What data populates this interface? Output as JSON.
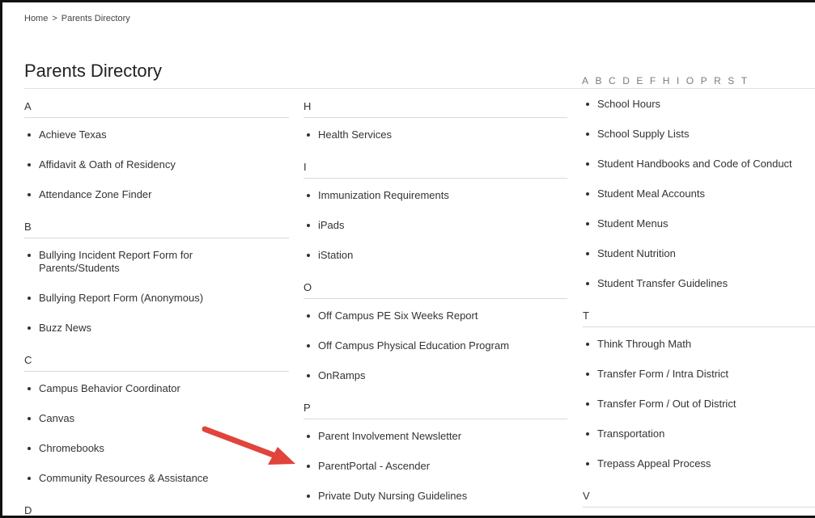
{
  "breadcrumb": {
    "home": "Home",
    "separator": ">",
    "current": "Parents Directory"
  },
  "page_title": "Parents Directory",
  "alpha_nav": [
    "A",
    "B",
    "C",
    "D",
    "E",
    "F",
    "H",
    "I",
    "O",
    "P",
    "R",
    "S",
    "T"
  ],
  "columns": [
    {
      "groups": [
        {
          "letter": "A",
          "items": [
            "Achieve Texas",
            "Affidavit & Oath of Residency",
            "Attendance Zone Finder"
          ]
        },
        {
          "letter": "B",
          "items": [
            "Bullying Incident Report Form for Parents/Students",
            "Bullying Report Form (Anonymous)",
            "Buzz News"
          ]
        },
        {
          "letter": "C",
          "items": [
            "Campus Behavior Coordinator",
            "Canvas",
            "Chromebooks",
            "Community Resources & Assistance"
          ]
        },
        {
          "letter": "D",
          "items": []
        }
      ]
    },
    {
      "groups": [
        {
          "letter": "H",
          "items": [
            "Health Services"
          ]
        },
        {
          "letter": "I",
          "items": [
            "Immunization Requirements",
            "iPads",
            "iStation"
          ]
        },
        {
          "letter": "O",
          "items": [
            "Off Campus PE Six Weeks Report",
            "Off Campus Physical Education Program",
            "OnRamps"
          ]
        },
        {
          "letter": "P",
          "items": [
            "Parent Involvement Newsletter",
            "ParentPortal - Ascender",
            "Private Duty Nursing Guidelines"
          ]
        }
      ]
    },
    {
      "s_items": [
        "School Hours",
        "School Supply Lists",
        "Student Handbooks and Code of Conduct",
        "Student Meal Accounts",
        "Student Menus",
        "Student Nutrition",
        "Student Transfer Guidelines"
      ],
      "groups": [
        {
          "letter": "T",
          "items": [
            "Think Through Math",
            "Transfer Form / Intra District",
            "Transfer Form / Out of District",
            "Transportation",
            "Trepass Appeal Process"
          ]
        },
        {
          "letter": "V",
          "items": []
        }
      ]
    }
  ],
  "annotation": {
    "arrow_color": "#e0443a",
    "icon": "red-arrow-icon"
  }
}
